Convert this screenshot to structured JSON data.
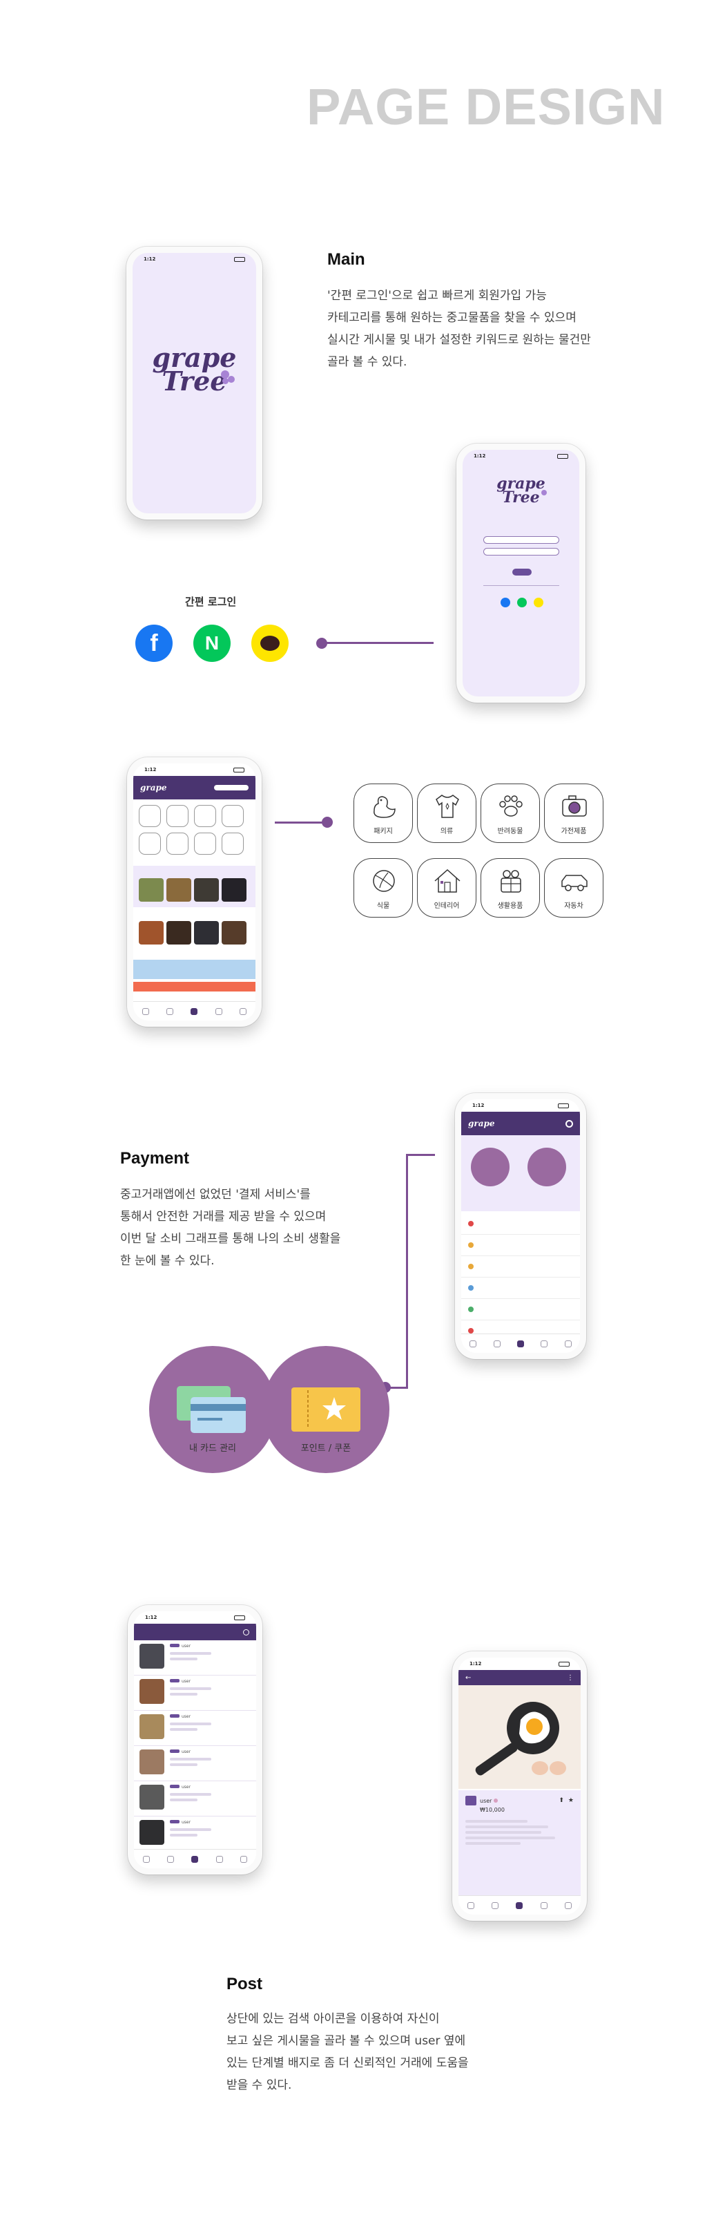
{
  "page_title": "PAGE DESIGN",
  "main": {
    "title": "Main",
    "body": "'간편 로그인'으로 쉽고 빠르게 회원가입 가능\n카테고리를 통해 원하는 중고물품을 찾을 수 있으며\n실시간 게시물 및 내가 설정한 키워드로 원하는 물건만\n골라  볼 수  있다."
  },
  "status_time": "1:12",
  "logo": {
    "line1": "grape",
    "line2": "Tree"
  },
  "login": {
    "title": "간편 로그인",
    "providers": [
      {
        "name": "facebook",
        "glyph": "f",
        "color": "#1877f2"
      },
      {
        "name": "naver",
        "glyph": "N",
        "color": "#03c75a"
      },
      {
        "name": "kakao",
        "color": "#fee500"
      }
    ]
  },
  "categories": [
    {
      "label": "패키지",
      "icon": "duck-icon"
    },
    {
      "label": "의류",
      "icon": "shirt-icon"
    },
    {
      "label": "반려동물",
      "icon": "paw-icon"
    },
    {
      "label": "가전제품",
      "icon": "camera-icon"
    },
    {
      "label": "식물",
      "icon": "leaf-icon"
    },
    {
      "label": "인테리어",
      "icon": "house-icon"
    },
    {
      "label": "생활용품",
      "icon": "gift-icon"
    },
    {
      "label": "자동차",
      "icon": "car-icon"
    }
  ],
  "payment": {
    "title": "Payment",
    "body": "중고거래앱에선 없었던 '결제 서비스'를\n통해서 안전한 거래를 제공 받을 수 있으며\n이번 달 소비 그래프를 통해 나의 소비 생활을\n한  눈에 볼 수 있다.",
    "card_label": "내 카드 관리",
    "coupon_label": "포인트 / 쿠폰"
  },
  "post": {
    "title": "Post",
    "body": "상단에 있는 검색 아이콘을 이용하여 자신이\n보고 싶은 게시물을 골라 볼 수 있으며 user 옆에\n있는 단계별 배지로 좀 더 신뢰적인 거래에 도움을\n받을 수 있다.",
    "user": "user",
    "price": "₩10,000"
  },
  "colors": {
    "accent": "#4a3470",
    "line": "#7d4f93",
    "circle": "#9a6aa0",
    "screen_bg": "#efe9fb"
  }
}
